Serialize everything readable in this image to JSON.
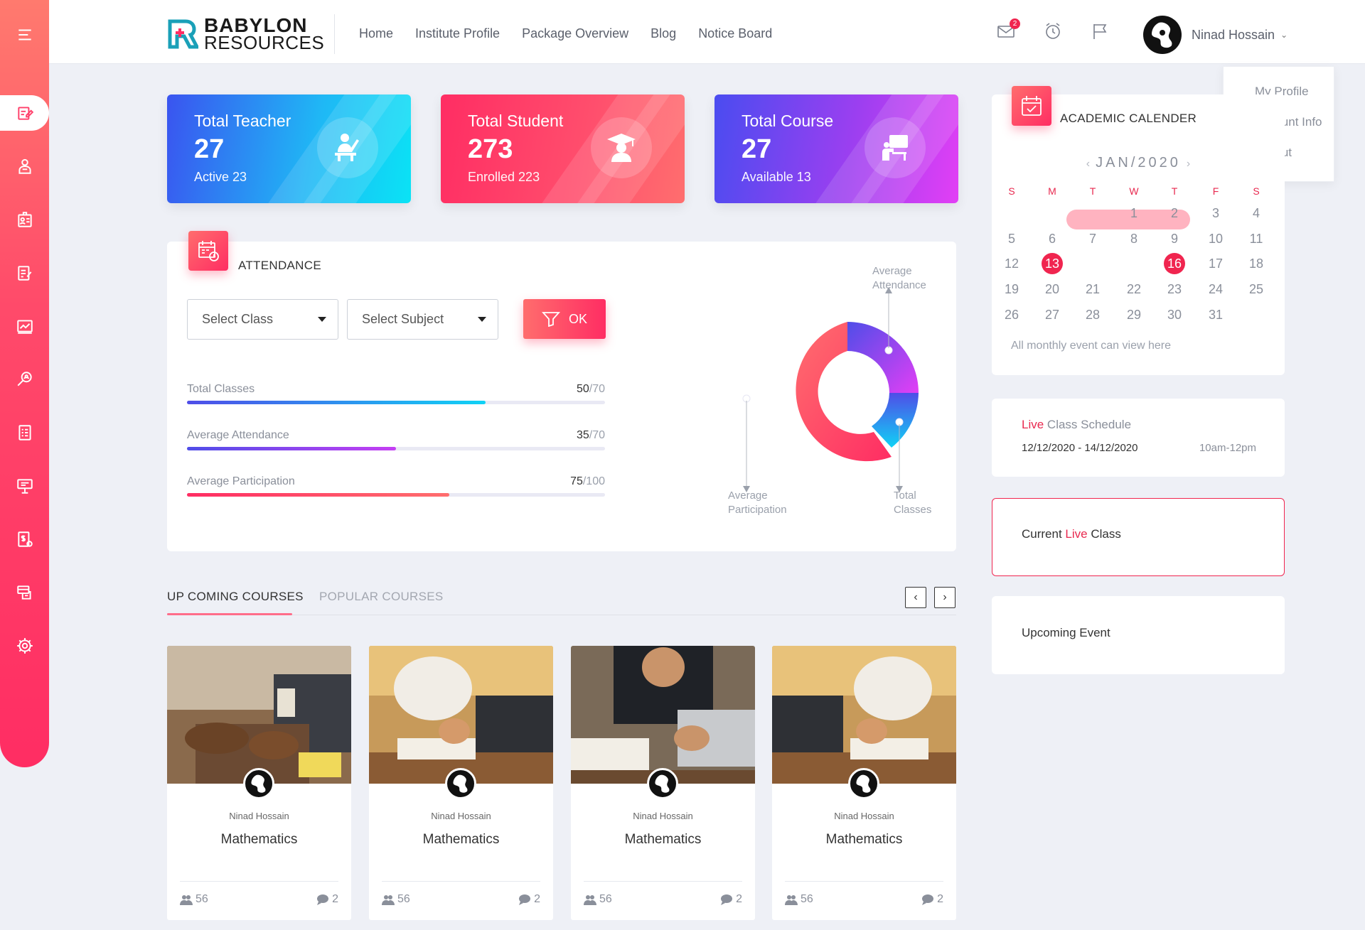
{
  "brand": {
    "line1": "BABYLON",
    "line2": "RESOURCES",
    "accent": "#ff2d63"
  },
  "nav": [
    "Home",
    "Institute Profile",
    "Package Overview",
    "Blog",
    "Notice Board"
  ],
  "header": {
    "mail_badge": "2",
    "user_name": "Ninad Hossain",
    "icons": [
      "mail-icon",
      "alarm-clock-icon",
      "flag-icon"
    ]
  },
  "profile_menu": [
    "My Profile",
    "Account Info",
    "Logout"
  ],
  "sidebar": [
    "menu-icon",
    "edit-icon",
    "teacher-icon",
    "id-card-icon",
    "notes-icon",
    "chart-icon",
    "search-user-icon",
    "checklist-icon",
    "presentation-icon",
    "invoice-icon",
    "payment-icon",
    "settings-icon"
  ],
  "stats": [
    {
      "title": "Total Teacher",
      "value": "27",
      "sub": "Active 23",
      "icon": "teacher-icon"
    },
    {
      "title": "Total Student",
      "value": "273",
      "sub": "Enrolled 223",
      "icon": "graduate-icon"
    },
    {
      "title": "Total Course",
      "value": "27",
      "sub": "Available 13",
      "icon": "course-icon"
    }
  ],
  "attendance": {
    "title": "ATTENDANCE",
    "select_class": "Select Class",
    "select_subject": "Select Subject",
    "ok_label": "OK",
    "bars": [
      {
        "label": "Total Classes",
        "value": "50",
        "max": "/70",
        "fraction": 0.714
      },
      {
        "label": "Average Attendance",
        "value": "35",
        "max": "/70",
        "fraction": 0.5
      },
      {
        "label": "Average Participation",
        "value": "75",
        "max": "/100",
        "fraction": 0.628
      }
    ],
    "donut_labels": {
      "attendance_1": "Average",
      "attendance_2": "Attendance",
      "participation_1": "Average",
      "participation_2": "Participation",
      "classes_1": "Total",
      "classes_2": "Classes"
    }
  },
  "courses": {
    "tab_upcoming": "UP COMING COURSES",
    "tab_popular": "POPULAR COURSES",
    "prev": "‹",
    "next": "›",
    "items": [
      {
        "author": "Ninad Hossain",
        "subject": "Mathematics",
        "students": "56",
        "comments": "2"
      },
      {
        "author": "Ninad Hossain",
        "subject": "Mathematics",
        "students": "56",
        "comments": "2"
      },
      {
        "author": "Ninad Hossain",
        "subject": "Mathematics",
        "students": "56",
        "comments": "2"
      },
      {
        "author": "Ninad Hossain",
        "subject": "Mathematics",
        "students": "56",
        "comments": "2"
      }
    ]
  },
  "calendar": {
    "title": "ACADEMIC CALENDER",
    "month": "JAN/2020",
    "prev": "‹",
    "next": "›",
    "day_heads": [
      "S",
      "M",
      "T",
      "W",
      "T",
      "F",
      "S"
    ],
    "weeks": [
      [
        "",
        "",
        "",
        "1",
        "2",
        "3",
        "4"
      ],
      [
        "5",
        "6",
        "7",
        "8",
        "9",
        "10",
        "11"
      ],
      [
        "12",
        "13",
        "14",
        "15",
        "16",
        "17",
        "18"
      ],
      [
        "19",
        "20",
        "21",
        "22",
        "23",
        "24",
        "25"
      ],
      [
        "26",
        "27",
        "28",
        "29",
        "30",
        "31",
        ""
      ]
    ],
    "note": "All monthly event can view here"
  },
  "live_schedule": {
    "live": "Live",
    "rest": " Class Schedule",
    "dates": "12/12/2020 - 14/12/2020",
    "time": "10am-12pm"
  },
  "current_live": {
    "pre": "Current ",
    "live": "Live",
    "post": " Class"
  },
  "upcoming_event": "Upcoming Event"
}
